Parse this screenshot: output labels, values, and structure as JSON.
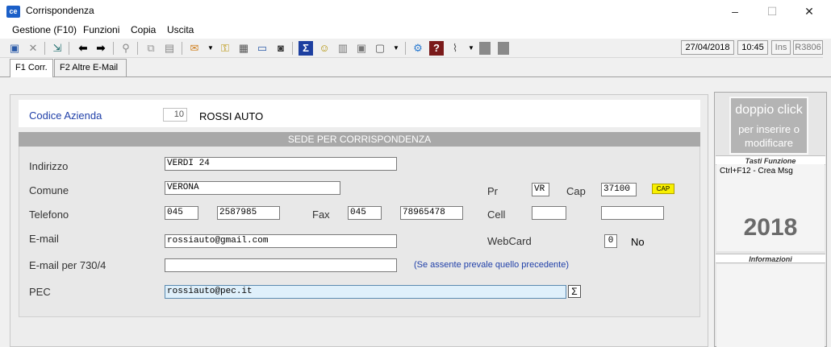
{
  "window": {
    "title": "Corrispondenza",
    "app_icon_text": "ce",
    "minimize": "–",
    "maximize": "☐",
    "close": "✕"
  },
  "menu": {
    "items": [
      "Gestione (F10)",
      "Funzioni",
      "Copia",
      "Uscita"
    ]
  },
  "toolbar": {
    "icons": [
      "save-icon",
      "delete-icon",
      "exit-door-icon",
      "back-arrow-icon",
      "forward-arrow-icon",
      "search-icon",
      "copy-icon",
      "paste-icon",
      "email-icon",
      "dropdown-icon",
      "key-icon",
      "calendar-grid-icon",
      "keyboard-icon",
      "camera-icon",
      "sum-icon",
      "smiley-icon",
      "grid-icon",
      "card-icon",
      "window-icon",
      "dropdown-icon",
      "network-icon",
      "help-icon",
      "attach-icon",
      "dropdown-icon",
      "block-icon",
      "block-icon"
    ],
    "date": "27/04/2018",
    "time": "10:45",
    "ins": "Ins",
    "release": "R3806"
  },
  "tabs": [
    "F1 Corr.",
    "F2 Altre E-Mail"
  ],
  "azienda": {
    "label": "Codice Azienda",
    "code": "10",
    "name": "ROSSI AUTO"
  },
  "sede": {
    "header": "SEDE PER CORRISPONDENZA",
    "labels": {
      "indirizzo": "Indirizzo",
      "comune": "Comune",
      "pr": "Pr",
      "cap": "Cap",
      "telefono": "Telefono",
      "fax": "Fax",
      "cell": "Cell",
      "email": "E-mail",
      "webcard": "WebCard",
      "email730": "E-mail per 730/4",
      "pec": "PEC"
    },
    "values": {
      "indirizzo": "VERDI 24",
      "comune": "VERONA",
      "pr": "VR",
      "cap": "37100",
      "tel_prefix": "045",
      "tel_number": "2587985",
      "fax_prefix": "045",
      "fax_number": "78965478",
      "cell_prefix": "",
      "cell_number": "",
      "email": "rossiauto@gmail.com",
      "webcard_code": "0",
      "webcard_text": "No",
      "email730": "",
      "pec": "rossiauto@pec.it"
    },
    "cap_button": "CAP",
    "note_730": "(Se assente prevale quello precedente)",
    "sigma": "Σ"
  },
  "sidebar": {
    "dbl_title": "doppio click",
    "dbl_sub": "per inserire o modificare",
    "tasti_header": "Tasti Funzione",
    "fkey": "Ctrl+F12   - Crea Msg",
    "year": "2018",
    "info_header": "Informazioni"
  },
  "colors": {
    "label_blue": "#1f3fa8",
    "cap_yellow": "#f8f000",
    "pec_highlight": "#dff0fb"
  }
}
